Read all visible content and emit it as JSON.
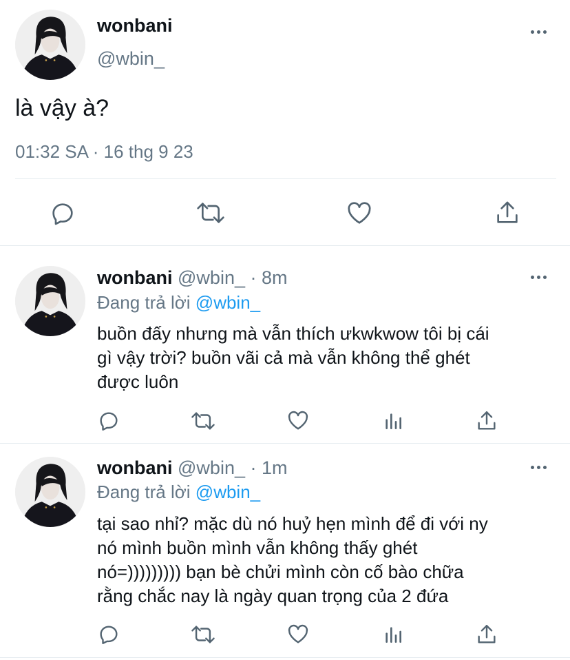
{
  "main_tweet": {
    "display_name": "wonbani",
    "handle": "@wbin_",
    "text": "là vậy à?",
    "timestamp": "01:32 SA · 16 thg 9 23",
    "actions": [
      "reply-icon",
      "retweet-icon",
      "like-icon",
      "share-icon"
    ]
  },
  "replies": [
    {
      "display_name": "wonbani",
      "handle": "@wbin_",
      "time": "· 8m",
      "replying_label": "Đang trả lời",
      "replying_to": "@wbin_",
      "text_lines": [
        "buồn đấy nhưng mà vẫn thích ưkwkwow tôi bị cái",
        "gì vậy trời? buồn vãi cả mà vẫn không thể ghét",
        "được luôn"
      ],
      "actions": [
        "reply-icon",
        "retweet-icon",
        "like-icon",
        "analytics-icon",
        "share-icon"
      ]
    },
    {
      "display_name": "wonbani",
      "handle": "@wbin_",
      "time": "· 1m",
      "replying_label": "Đang trả lời",
      "replying_to": "@wbin_",
      "text_lines": [
        "tại sao nhỉ? mặc dù nó huỷ hẹn mình để đi với ny",
        "nó mình buồn mình vẫn không thấy ghét",
        "nó=))))))))) bạn bè chửi mình còn cố bào chữa",
        "rằng chắc nay là ngày quan trọng của 2 đứa"
      ],
      "actions": [
        "reply-icon",
        "retweet-icon",
        "like-icon",
        "analytics-icon",
        "share-icon"
      ]
    }
  ],
  "colors": {
    "text": "#0f1419",
    "muted": "#657786",
    "link": "#1d9bf0",
    "icon": "#536471",
    "divider": "#e6ecf0"
  }
}
